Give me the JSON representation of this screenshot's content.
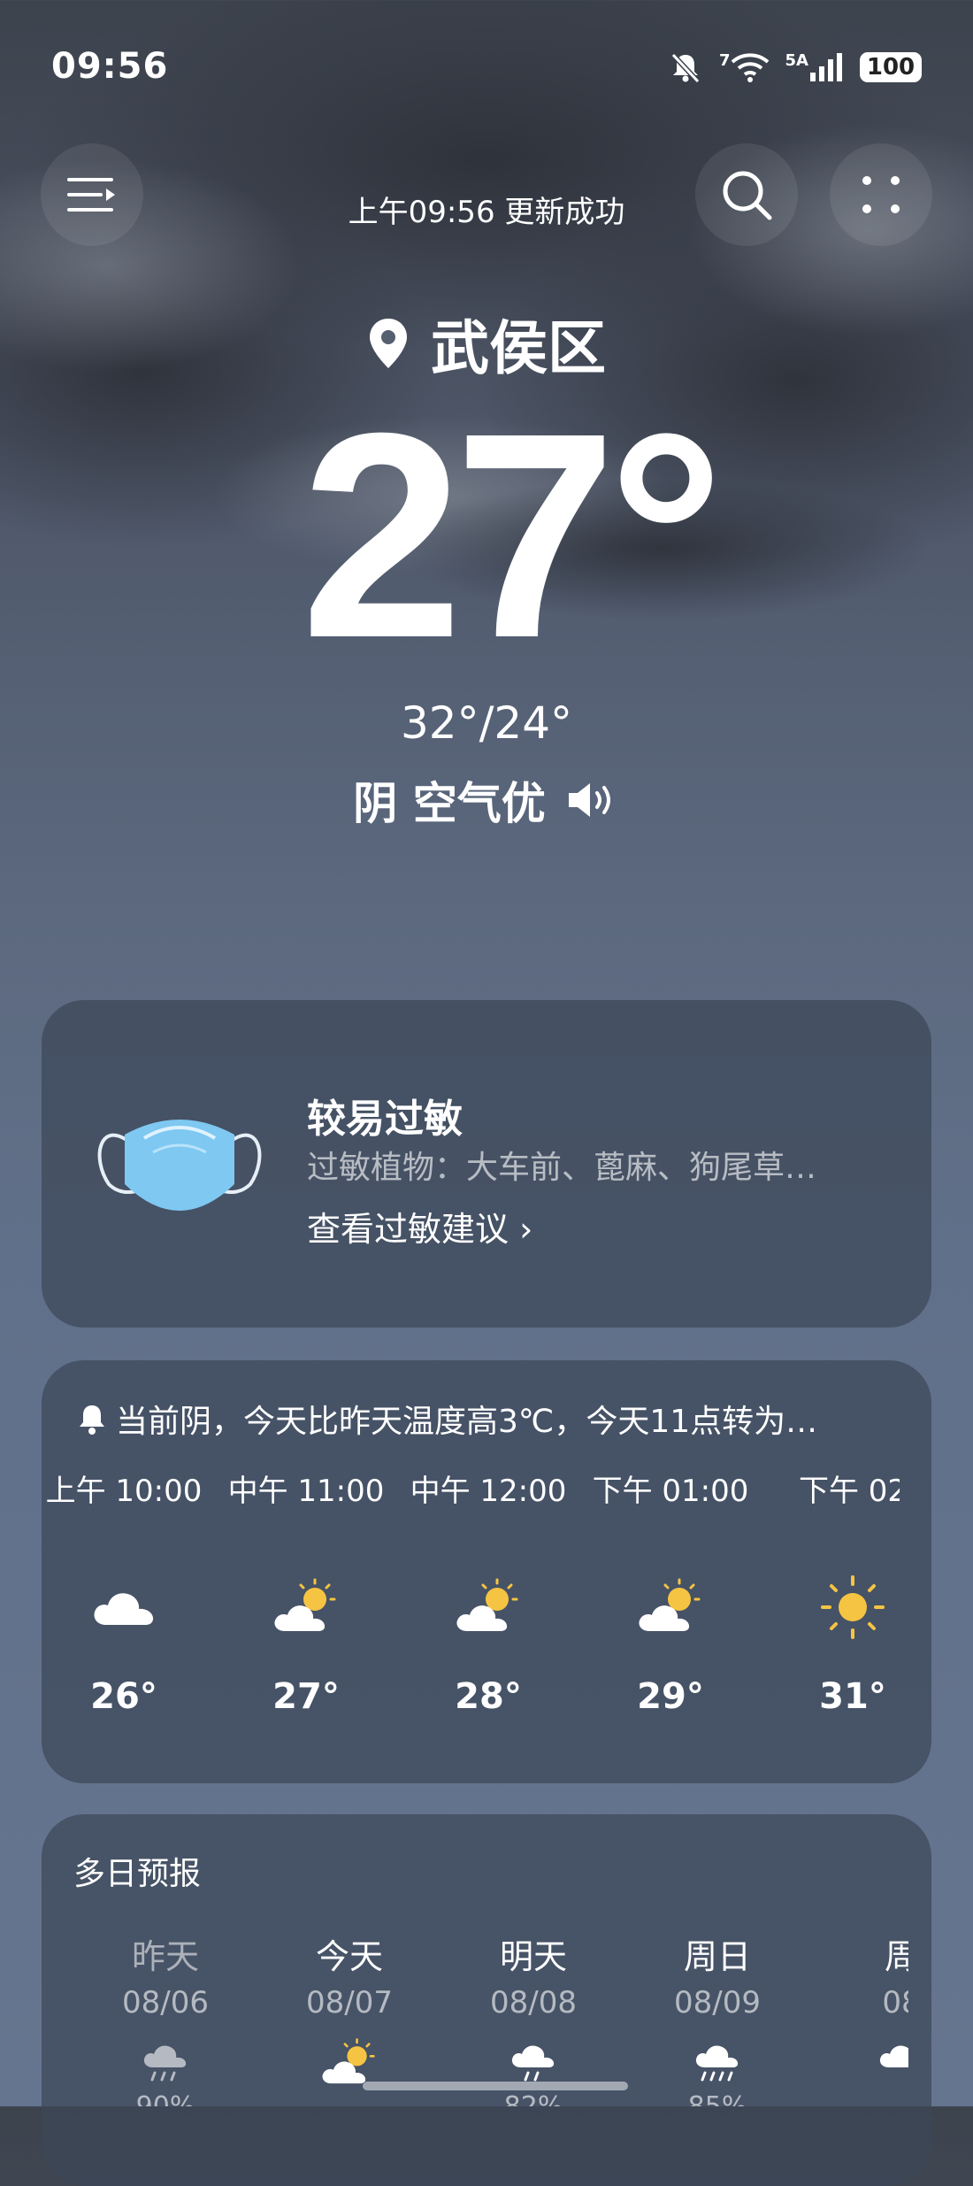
{
  "status": {
    "time": "09:56",
    "signal_7": "7",
    "signal_5a": "5A",
    "battery": "100"
  },
  "header": {
    "update_text": "上午09:56 更新成功"
  },
  "location": {
    "name": "武侯区"
  },
  "current": {
    "temp": "27°",
    "hilo": "32°/24°",
    "condition": "阴 空气优"
  },
  "allergy": {
    "title": "较易过敏",
    "plants": "过敏植物：大车前、蓖麻、狗尾草…",
    "link": "查看过敏建议 ›"
  },
  "hourly": {
    "notice": "当前阴，今天比昨天温度高3℃，今天11点转为…",
    "items": [
      {
        "time": "上午 10:00",
        "icon": "cloud-icon",
        "temp": "26°"
      },
      {
        "time": "中午 11:00",
        "icon": "partly-sunny-icon",
        "temp": "27°"
      },
      {
        "time": "中午 12:00",
        "icon": "partly-sunny-icon",
        "temp": "28°"
      },
      {
        "time": "下午 01:00",
        "icon": "partly-sunny-icon",
        "temp": "29°"
      },
      {
        "time": "下午 02",
        "icon": "sun-icon",
        "temp": "31°"
      }
    ]
  },
  "daily": {
    "title": "多日预报",
    "items": [
      {
        "name": "昨天",
        "date": "08/06",
        "icon": "rain-cloud-icon",
        "pop": "90%"
      },
      {
        "name": "今天",
        "date": "08/07",
        "icon": "partly-sunny-icon",
        "pop": ""
      },
      {
        "name": "明天",
        "date": "08/08",
        "icon": "rain-cloud-icon",
        "pop": "82%"
      },
      {
        "name": "周日",
        "date": "08/09",
        "icon": "rain-cloud-icon",
        "pop": "85%"
      },
      {
        "name": "周",
        "date": "08",
        "icon": "rain-cloud-icon",
        "pop": ""
      }
    ]
  },
  "colors": {
    "sun": "#f6c443",
    "mask": "#7ec8f2",
    "card": "#3c4658"
  }
}
